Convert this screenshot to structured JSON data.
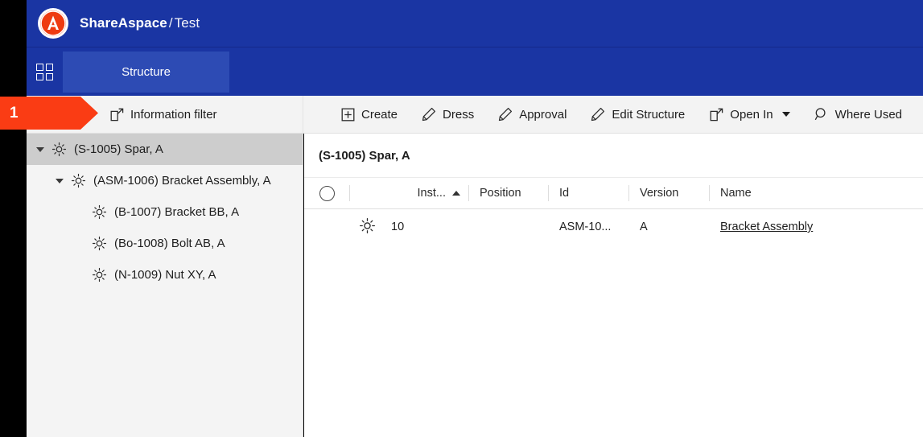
{
  "header": {
    "brand_main": "ShareAspace",
    "brand_separator": "/",
    "brand_sub": "Test",
    "logo_letter": "A",
    "bg_color": "#1a35a3"
  },
  "nav": {
    "apps_icon": "grid-apps-icon",
    "tabs": [
      {
        "label": "Structure",
        "active": true
      }
    ]
  },
  "callout": {
    "number": "1",
    "color": "#fa3c14"
  },
  "left_toolbar": {
    "buttons": [
      {
        "label": "Information filter",
        "icon": "external-link-icon"
      }
    ]
  },
  "toolbar": {
    "buttons": [
      {
        "label": "Create",
        "icon": "plus-box-icon"
      },
      {
        "label": "Dress",
        "icon": "pencil-icon"
      },
      {
        "label": "Approval",
        "icon": "pencil-icon"
      },
      {
        "label": "Edit Structure",
        "icon": "pencil-icon"
      },
      {
        "label": "Open In",
        "icon": "external-link-icon",
        "has_caret": true
      },
      {
        "label": "Where Used",
        "icon": "search-icon"
      }
    ]
  },
  "tree": {
    "items": [
      {
        "label": "(S-1005) Spar, A",
        "depth": 0,
        "expanded": true,
        "has_caret": true,
        "selected": true
      },
      {
        "label": "(ASM-1006) Bracket Assembly, A",
        "depth": 1,
        "expanded": true,
        "has_caret": true,
        "selected": false
      },
      {
        "label": "(B-1007) Bracket BB, A",
        "depth": 2,
        "expanded": false,
        "has_caret": false,
        "selected": false
      },
      {
        "label": "(Bo-1008) Bolt AB, A",
        "depth": 2,
        "expanded": false,
        "has_caret": false,
        "selected": false
      },
      {
        "label": "(N-1009) Nut XY, A",
        "depth": 2,
        "expanded": false,
        "has_caret": false,
        "selected": false
      }
    ]
  },
  "main": {
    "title": "(S-1005) Spar, A",
    "grid": {
      "columns": [
        {
          "key": "select",
          "label": ""
        },
        {
          "key": "instance",
          "label": "Inst...",
          "sorted": "asc"
        },
        {
          "key": "position",
          "label": "Position"
        },
        {
          "key": "id",
          "label": "Id"
        },
        {
          "key": "version",
          "label": "Version"
        },
        {
          "key": "name",
          "label": "Name"
        }
      ],
      "rows": [
        {
          "icon": "gear-icon",
          "instance": "10",
          "position": "",
          "id": "ASM-10...",
          "version": "A",
          "name": "Bracket Assembly"
        }
      ]
    }
  }
}
